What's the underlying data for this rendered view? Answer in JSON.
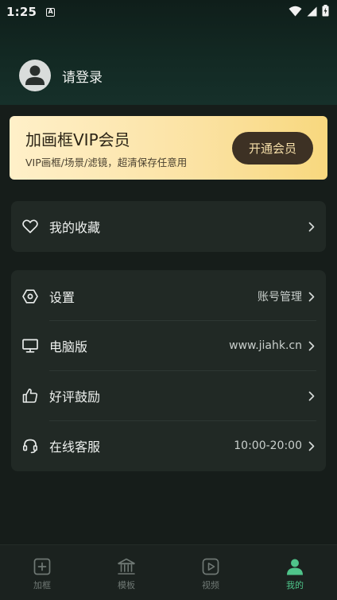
{
  "status_bar": {
    "time": "1:25",
    "app_icon_letter": "A"
  },
  "profile": {
    "login_text": "请登录"
  },
  "vip": {
    "title": "加画框VIP会员",
    "subtitle": "VIP画框/场景/滤镜，超清保存任意用",
    "button": "开通会员"
  },
  "favorites": {
    "label": "我的收藏"
  },
  "menu": {
    "items": [
      {
        "label": "设置",
        "value": "账号管理",
        "icon": "hexagon-settings-icon"
      },
      {
        "label": "电脑版",
        "value": "www.jiahk.cn",
        "icon": "monitor-icon"
      },
      {
        "label": "好评鼓励",
        "value": "",
        "icon": "thumbs-up-icon"
      },
      {
        "label": "在线客服",
        "value": "10:00-20:00",
        "icon": "headset-icon"
      }
    ]
  },
  "tabs": [
    {
      "label": "加框",
      "icon": "add-frame-icon",
      "active": false
    },
    {
      "label": "模板",
      "icon": "bank-template-icon",
      "active": false
    },
    {
      "label": "视频",
      "icon": "play-video-icon",
      "active": false
    },
    {
      "label": "我的",
      "icon": "person-icon",
      "active": true
    }
  ],
  "colors": {
    "accent": "#4fc48a",
    "vip_button": "#3d3124",
    "vip_gold": "#f8d87e"
  }
}
